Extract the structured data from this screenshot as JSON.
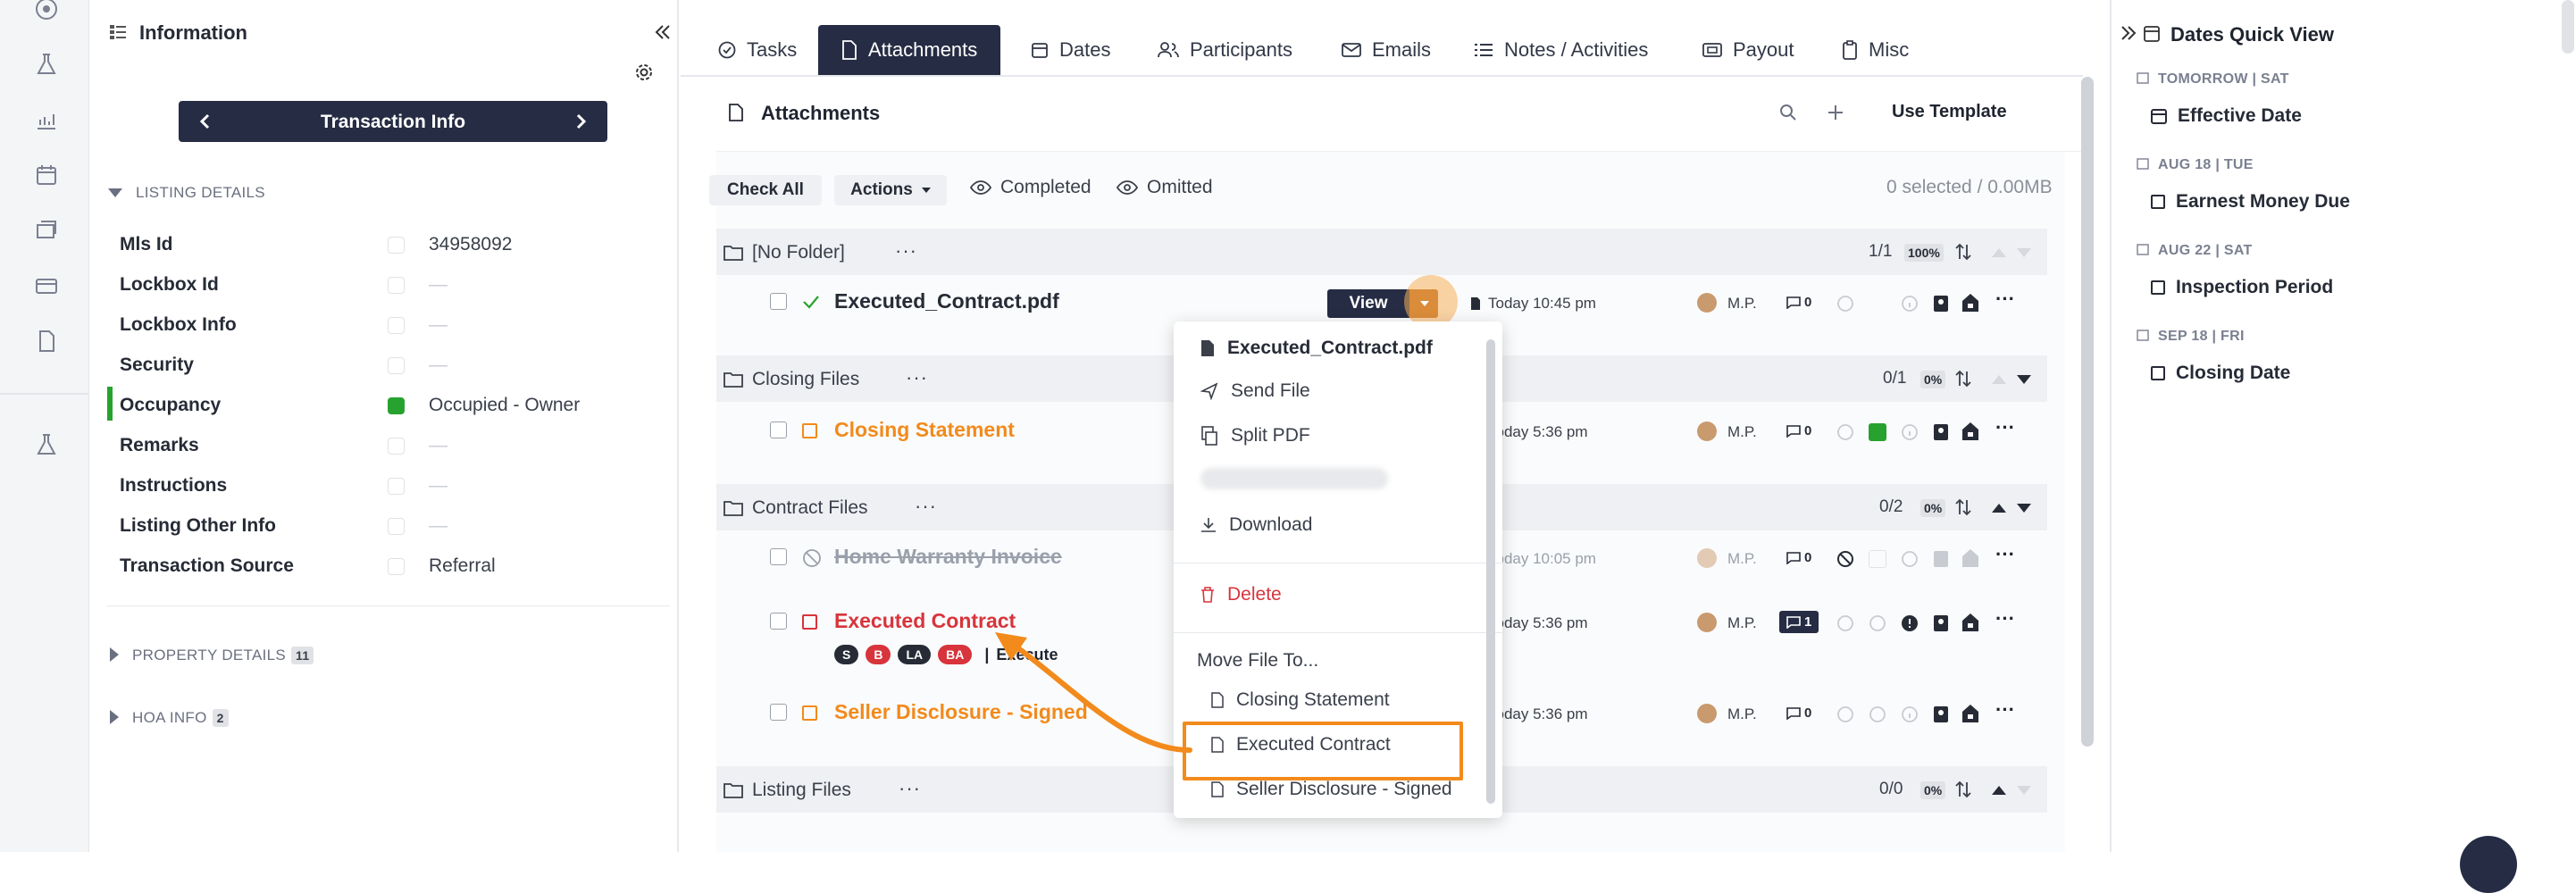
{
  "left_panel": {
    "title": "Information",
    "nav_label": "Transaction Info",
    "listing_details_heading": "LISTING DETAILS",
    "fields": [
      {
        "label": "Mls Id",
        "value": "34958092"
      },
      {
        "label": "Lockbox Id",
        "value": "—"
      },
      {
        "label": "Lockbox Info",
        "value": "—"
      },
      {
        "label": "Security",
        "value": "—"
      },
      {
        "label": "Occupancy",
        "value": "Occupied - Owner"
      },
      {
        "label": "Remarks",
        "value": "—"
      },
      {
        "label": "Instructions",
        "value": "—"
      },
      {
        "label": "Listing Other Info",
        "value": "—"
      },
      {
        "label": "Transaction Source",
        "value": "Referral"
      }
    ],
    "property_details": {
      "label": "PROPERTY DETAILS",
      "count": "11"
    },
    "hoa_info": {
      "label": "HOA INFO",
      "count": "2"
    }
  },
  "tabs": [
    "Tasks",
    "Attachments",
    "Dates",
    "Participants",
    "Emails",
    "Notes / Activities",
    "Payout",
    "Misc"
  ],
  "attachments": {
    "header": "Attachments",
    "use_template": "Use Template",
    "check_all": "Check All",
    "actions": "Actions",
    "completed": "Completed",
    "omitted": "Omitted",
    "selection": "0 selected / 0.00MB",
    "folders": [
      {
        "name": "[No Folder]",
        "fraction": "1/1",
        "percent": "100%"
      },
      {
        "name": "Closing Files",
        "fraction": "0/1",
        "percent": "0%"
      },
      {
        "name": "Contract Files",
        "fraction": "0/2",
        "percent": "0%"
      },
      {
        "name": "Listing Files",
        "fraction": "0/0",
        "percent": "0%"
      }
    ],
    "files": [
      {
        "name": "Executed_Contract.pdf",
        "time": "Today 10:45 pm",
        "user": "M.P.",
        "comments": "0"
      },
      {
        "name": "Closing Statement",
        "time": "Today 5:36 pm",
        "user": "M.P.",
        "comments": "0"
      },
      {
        "name": "Home Warranty Invoice",
        "time": "Today 10:05 pm",
        "user": "M.P.",
        "comments": "0"
      },
      {
        "name": "Executed Contract",
        "time": "Today 5:36 pm",
        "user": "M.P.",
        "comments": "1"
      },
      {
        "name": "Seller Disclosure - Signed",
        "time": "Today 5:36 pm",
        "user": "M.P.",
        "comments": "0"
      }
    ],
    "view_button": "View",
    "tags": [
      "S",
      "B",
      "LA",
      "BA"
    ],
    "execute_label": "Execute"
  },
  "menu": {
    "file_title": "Executed_Contract.pdf",
    "send_file": "Send File",
    "split_pdf": "Split PDF",
    "download": "Download",
    "delete": "Delete",
    "move_heading": "Move File To...",
    "targets": [
      "Closing Statement",
      "Executed Contract",
      "Seller Disclosure - Signed"
    ]
  },
  "dates_panel": {
    "title": "Dates Quick View",
    "items": [
      {
        "date": "TOMORROW | SAT",
        "label": "Effective Date"
      },
      {
        "date": "AUG 18 | TUE",
        "label": "Earnest Money Due"
      },
      {
        "date": "AUG 22 | SAT",
        "label": "Inspection Period"
      },
      {
        "date": "SEP 18 | FRI",
        "label": "Closing Date"
      }
    ]
  },
  "colors": {
    "navy": "#252c43",
    "orange": "#f28a1c",
    "red": "#d8343c",
    "green": "#27a22e"
  }
}
